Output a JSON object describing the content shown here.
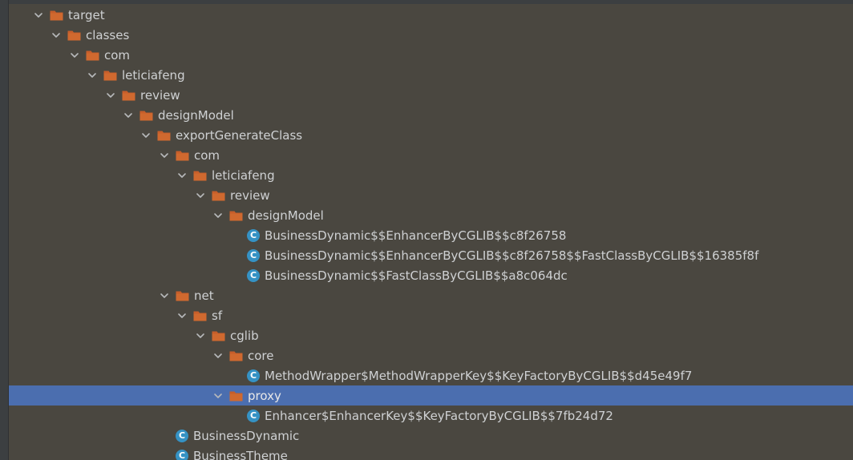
{
  "colors": {
    "background": "#4a4740",
    "selection": "#4b6eaf",
    "folder": "#c75e2a",
    "class_badge": "#3592c4",
    "text": "#cfd1d3"
  },
  "tree": {
    "rows": [
      {
        "label": "target",
        "type": "folder",
        "depth": 1,
        "expanded": true
      },
      {
        "label": "classes",
        "type": "folder",
        "depth": 2,
        "expanded": true
      },
      {
        "label": "com",
        "type": "folder",
        "depth": 3,
        "expanded": true
      },
      {
        "label": "leticiafeng",
        "type": "folder",
        "depth": 4,
        "expanded": true
      },
      {
        "label": "review",
        "type": "folder",
        "depth": 5,
        "expanded": true
      },
      {
        "label": "designModel",
        "type": "folder",
        "depth": 6,
        "expanded": true
      },
      {
        "label": "exportGenerateClass",
        "type": "folder",
        "depth": 7,
        "expanded": true
      },
      {
        "label": "com",
        "type": "folder",
        "depth": 8,
        "expanded": true
      },
      {
        "label": "leticiafeng",
        "type": "folder",
        "depth": 9,
        "expanded": true
      },
      {
        "label": "review",
        "type": "folder",
        "depth": 10,
        "expanded": true
      },
      {
        "label": "designModel",
        "type": "folder",
        "depth": 11,
        "expanded": true
      },
      {
        "label": "BusinessDynamic$$EnhancerByCGLIB$$c8f26758",
        "type": "class",
        "depth": 12
      },
      {
        "label": "BusinessDynamic$$EnhancerByCGLIB$$c8f26758$$FastClassByCGLIB$$16385f8f",
        "type": "class",
        "depth": 12
      },
      {
        "label": "BusinessDynamic$$FastClassByCGLIB$$a8c064dc",
        "type": "class",
        "depth": 12
      },
      {
        "label": "net",
        "type": "folder",
        "depth": 8,
        "expanded": true
      },
      {
        "label": "sf",
        "type": "folder",
        "depth": 9,
        "expanded": true
      },
      {
        "label": "cglib",
        "type": "folder",
        "depth": 10,
        "expanded": true
      },
      {
        "label": "core",
        "type": "folder",
        "depth": 11,
        "expanded": true
      },
      {
        "label": "MethodWrapper$MethodWrapperKey$$KeyFactoryByCGLIB$$d45e49f7",
        "type": "class",
        "depth": 12
      },
      {
        "label": "proxy",
        "type": "folder",
        "depth": 11,
        "expanded": true,
        "selected": true
      },
      {
        "label": "Enhancer$EnhancerKey$$KeyFactoryByCGLIB$$7fb24d72",
        "type": "class",
        "depth": 12
      },
      {
        "label": "BusinessDynamic",
        "type": "class",
        "depth": 8
      },
      {
        "label": "BusinessTheme",
        "type": "class",
        "depth": 8
      }
    ]
  }
}
